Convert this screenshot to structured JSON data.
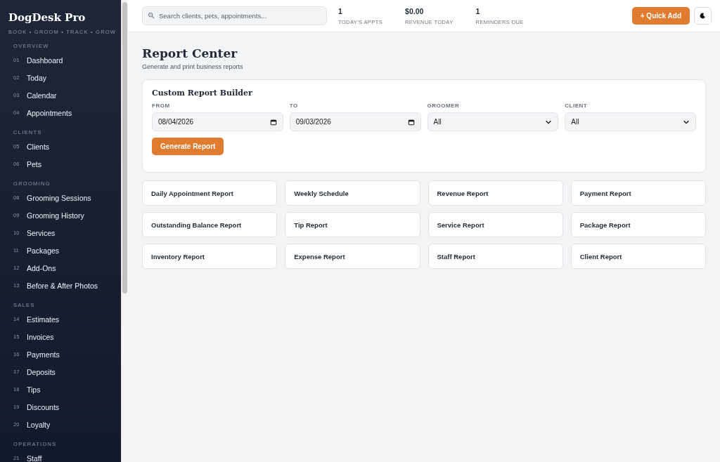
{
  "brand": {
    "name": "DogDesk Pro",
    "tagline": "BOOK • GROOM • TRACK • GROW"
  },
  "sidebar": {
    "sections": [
      {
        "title": "OVERVIEW",
        "items": [
          {
            "num": "01",
            "label": "Dashboard"
          },
          {
            "num": "02",
            "label": "Today"
          },
          {
            "num": "03",
            "label": "Calendar"
          },
          {
            "num": "04",
            "label": "Appointments"
          }
        ]
      },
      {
        "title": "CLIENTS",
        "items": [
          {
            "num": "05",
            "label": "Clients"
          },
          {
            "num": "06",
            "label": "Pets"
          }
        ]
      },
      {
        "title": "GROOMING",
        "items": [
          {
            "num": "08",
            "label": "Grooming Sessions"
          },
          {
            "num": "09",
            "label": "Grooming History"
          },
          {
            "num": "10",
            "label": "Services"
          },
          {
            "num": "11",
            "label": "Packages"
          },
          {
            "num": "12",
            "label": "Add-Ons"
          },
          {
            "num": "13",
            "label": "Before & After Photos"
          }
        ]
      },
      {
        "title": "SALES",
        "items": [
          {
            "num": "14",
            "label": "Estimates"
          },
          {
            "num": "15",
            "label": "Invoices"
          },
          {
            "num": "16",
            "label": "Payments"
          },
          {
            "num": "17",
            "label": "Deposits"
          },
          {
            "num": "18",
            "label": "Tips"
          },
          {
            "num": "19",
            "label": "Discounts"
          },
          {
            "num": "20",
            "label": "Loyalty"
          }
        ]
      },
      {
        "title": "OPERATIONS",
        "items": [
          {
            "num": "21",
            "label": "Staff"
          }
        ]
      }
    ]
  },
  "topbar": {
    "search": {
      "placeholder": "Search clients, pets, appointments..."
    },
    "stats": [
      {
        "value": "1",
        "label": "TODAY'S APPTS"
      },
      {
        "value": "$0.00",
        "label": "REVENUE TODAY"
      },
      {
        "value": "1",
        "label": "REMINDERS DUE"
      }
    ],
    "quick_add": "+ Quick Add"
  },
  "page": {
    "title": "Report Center",
    "subtitle": "Generate and print business reports"
  },
  "builder": {
    "title": "Custom Report Builder",
    "fields": [
      {
        "kind": "date",
        "label": "FROM",
        "value": "08/04/2026"
      },
      {
        "kind": "date",
        "label": "TO",
        "value": "09/03/2026"
      },
      {
        "kind": "select",
        "label": "GROOMER",
        "value": "All"
      },
      {
        "kind": "select",
        "label": "CLIENT",
        "value": "All"
      }
    ],
    "button": "Generate Report"
  },
  "reports": [
    "Daily Appointment Report",
    "Weekly Schedule",
    "Revenue Report",
    "Payment Report",
    "Outstanding Balance Report",
    "Tip Report",
    "Service Report",
    "Package Report",
    "Inventory Report",
    "Expense Report",
    "Staff Report",
    "Client Report"
  ]
}
